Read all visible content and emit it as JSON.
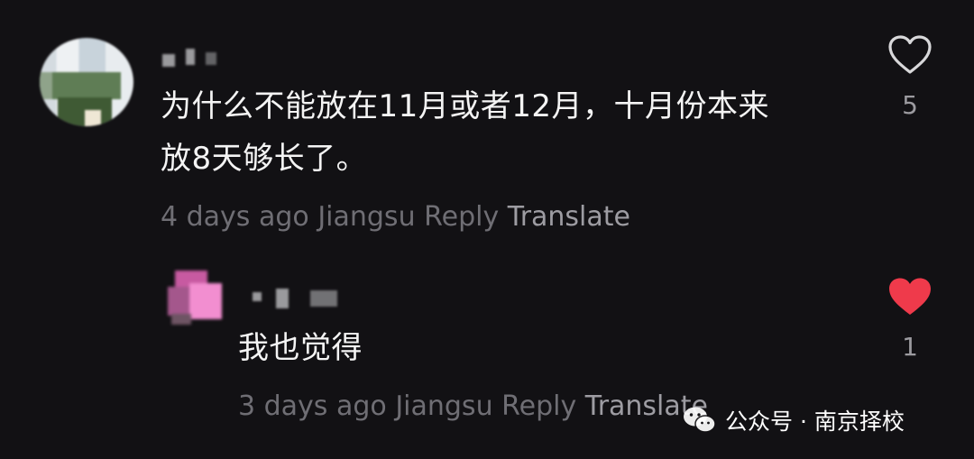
{
  "comments": [
    {
      "text_line1": "为什么不能放在11月或者12月，十月份本来",
      "text_line2": "放8天够长了。",
      "time": "4 days ago",
      "location": "Jiangsu",
      "reply_label": "Reply",
      "translate_label": "Translate",
      "like_count": "5",
      "liked": false
    },
    {
      "text_line1": "我也觉得",
      "time": "3 days ago",
      "location": "Jiangsu",
      "reply_label": "Reply",
      "translate_label": "Translate",
      "like_count": "1",
      "liked": true
    }
  ],
  "watermark": {
    "label": "公众号 · 南京择校"
  },
  "colors": {
    "background": "#121114",
    "like_red": "#ef3a4b",
    "meta_gray": "#6f6e74"
  }
}
